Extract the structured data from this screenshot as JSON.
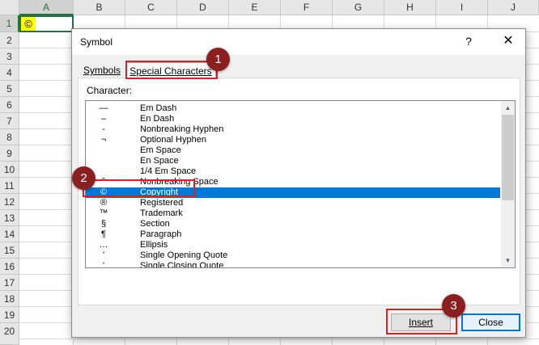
{
  "sheet": {
    "columns": [
      "A",
      "B",
      "C",
      "D",
      "E",
      "F",
      "G",
      "H",
      "I",
      "J"
    ],
    "rows": [
      "1",
      "2",
      "3",
      "4",
      "5",
      "6",
      "7",
      "8",
      "9",
      "10",
      "11",
      "12",
      "13",
      "14",
      "15",
      "16",
      "17",
      "18",
      "19",
      "20"
    ],
    "active_cell_value": "©"
  },
  "dialog": {
    "title": "Symbol",
    "help_glyph": "?",
    "close_glyph": "✕",
    "tabs": {
      "symbols": "Symbols",
      "special": "Special Characters"
    },
    "character_label": "Character:",
    "items": [
      {
        "glyph": "—",
        "name": "Em Dash"
      },
      {
        "glyph": "–",
        "name": "En Dash"
      },
      {
        "glyph": "-",
        "name": "Nonbreaking Hyphen"
      },
      {
        "glyph": "¬",
        "name": "Optional Hyphen"
      },
      {
        "glyph": "",
        "name": "Em Space"
      },
      {
        "glyph": "",
        "name": "En Space"
      },
      {
        "glyph": "",
        "name": "1/4 Em Space"
      },
      {
        "glyph": "°",
        "name": "Nonbreaking Space"
      },
      {
        "glyph": "©",
        "name": "Copyright"
      },
      {
        "glyph": "®",
        "name": "Registered"
      },
      {
        "glyph": "™",
        "name": "Trademark"
      },
      {
        "glyph": "§",
        "name": "Section"
      },
      {
        "glyph": "¶",
        "name": "Paragraph"
      },
      {
        "glyph": "…",
        "name": "Ellipsis"
      },
      {
        "glyph": "'",
        "name": "Single Opening Quote"
      },
      {
        "glyph": "'",
        "name": "Single Closing Quote"
      }
    ],
    "selected_item": "Copyright",
    "scroll_up": "▲",
    "scroll_down": "▼",
    "insert_label": "Insert",
    "close_label": "Close"
  },
  "callouts": [
    "1",
    "2",
    "3"
  ],
  "colors": {
    "accent": "#0078d7",
    "excel_green": "#217346",
    "callout_red": "#e02020",
    "badge": "#8b1f1f",
    "highlight": "#ffff00"
  }
}
